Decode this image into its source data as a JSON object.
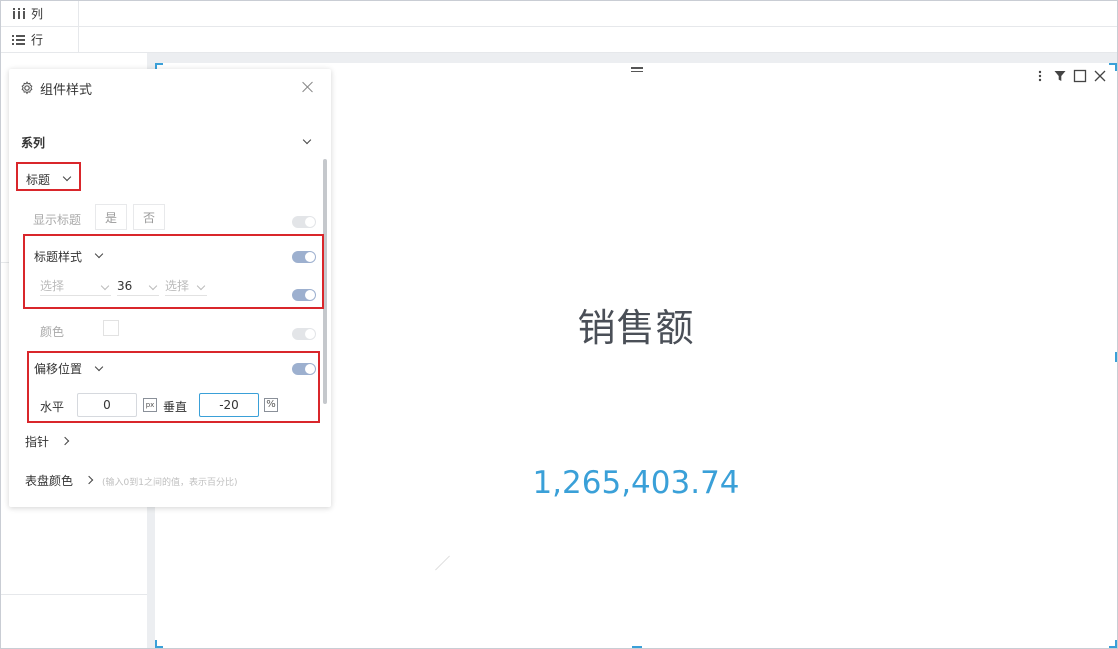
{
  "topbar": {
    "columns_label": "列",
    "rows_label": "行"
  },
  "panel": {
    "title": "组件样式",
    "series_label": "系列",
    "title_section_label": "标题",
    "show_title_label": "显示标题",
    "show_title_yes": "是",
    "show_title_no": "否",
    "title_style_label": "标题样式",
    "font_family_placeholder": "选择",
    "font_size_value": "36",
    "font_style_placeholder": "选择",
    "color_label": "颜色",
    "offset_label": "偏移位置",
    "horizontal_label": "水平",
    "horizontal_value": "0",
    "horizontal_unit": "px",
    "vertical_label": "垂直",
    "vertical_value": "-20",
    "vertical_unit": "%",
    "pointer_label": "指针",
    "dial_color_label": "表盘颜色",
    "dial_color_hint": "(输入0到1之间的值，表示百分比)"
  },
  "gauge": {
    "title": "销售额",
    "value": "1,265,403.74"
  },
  "colors": {
    "accent": "#3aa0d8",
    "highlight_border": "#d9262b",
    "toggle_on": "#9db0cf"
  }
}
